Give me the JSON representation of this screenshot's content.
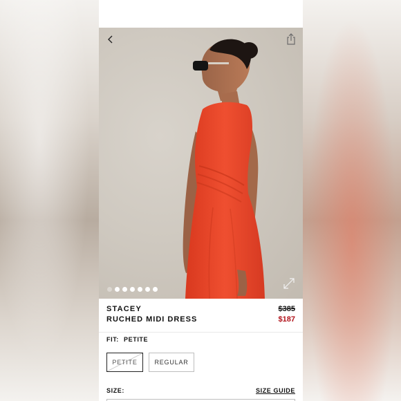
{
  "product": {
    "brand": "STACEY",
    "name": "RUCHED MIDI DRESS",
    "price_original": "$385",
    "price_sale": "$187"
  },
  "fit": {
    "label": "FIT:",
    "selected": "PETITE",
    "options": [
      "PETITE",
      "REGULAR"
    ]
  },
  "size": {
    "label": "SIZE:",
    "guide_link": "SIZE GUIDE"
  },
  "gallery": {
    "image_count": 7,
    "active_index": 0
  },
  "icons": {
    "back": "chevron-left-icon",
    "share": "share-icon",
    "expand": "expand-icon"
  },
  "colors": {
    "sale_price": "#b1121a",
    "dress": "#e8472c"
  }
}
